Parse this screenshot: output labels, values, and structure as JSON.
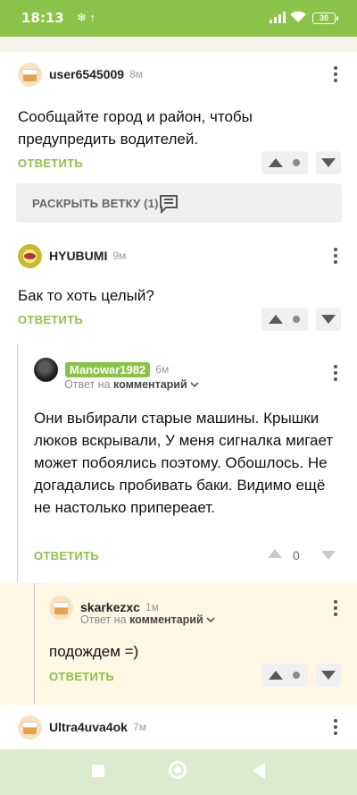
{
  "status_bar": {
    "time": "18:13",
    "notification_icons": "❄ ↑",
    "battery": "30"
  },
  "comments": [
    {
      "user": "user6545009",
      "time": "8м",
      "text": "Сообщайте город и район, чтобы предупредить водителей.",
      "reply_label": "ОТВЕТИТЬ"
    },
    {
      "user": "HYUBUMI",
      "time": "9м",
      "text": "Бак то хоть целый?",
      "reply_label": "ОТВЕТИТЬ"
    },
    {
      "user": "Manowar1982",
      "time": "6м",
      "reply_prefix": "Ответ на",
      "reply_target": "комментарий",
      "text": "Они выбирали старые машины. Крышки люков вскрывали, У меня сигналка мигает может побоялись поэтому. Обошлось. Не догадались пробивать баки. Видимо ещё не настолько припереает.",
      "reply_label": "ОТВЕТИТЬ",
      "rating": "0"
    },
    {
      "user": "skarkezxc",
      "time": "1м",
      "reply_prefix": "Ответ на",
      "reply_target": "комментарий",
      "text": "подождем =)",
      "reply_label": "ОТВЕТИТЬ"
    },
    {
      "user": "Ultra4uva4ok",
      "time": "7м"
    }
  ],
  "expand_branch": {
    "label": "РАСКРЫТЬ ВЕТКУ (1)"
  },
  "colors": {
    "accent": "#8bc34a",
    "nested_bg": "#fdf7e3",
    "navbar": "#dcebcd"
  }
}
